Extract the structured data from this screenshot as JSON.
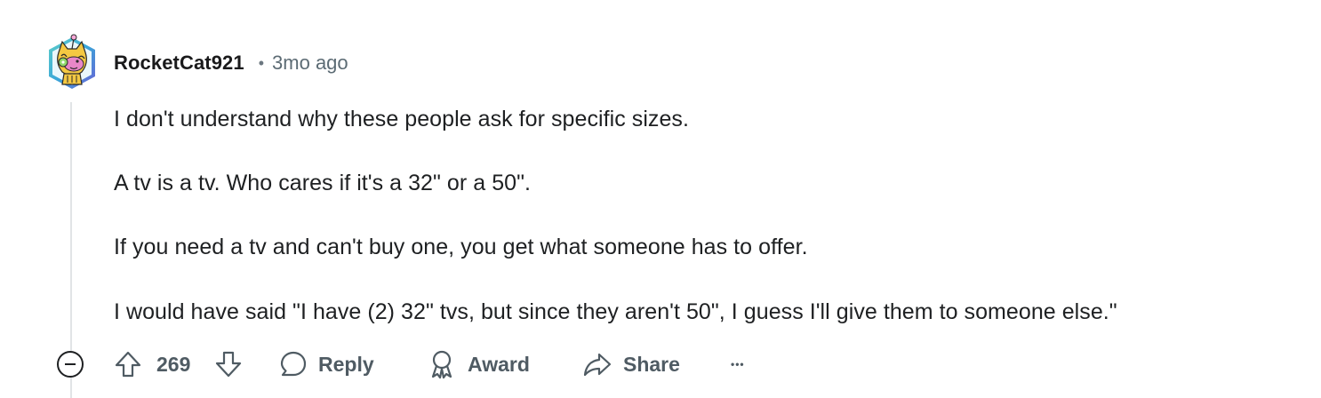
{
  "comment": {
    "author": "RocketCat921",
    "separator": "•",
    "timestamp": "3mo ago",
    "paragraphs": [
      "I don't understand why these people ask for specific sizes.",
      "A tv is a tv. Who cares if it's a 32\" or a 50\".",
      "If you need a tv and can't buy one, you get what someone has to offer.",
      "I would have said \"I have (2) 32\" tvs, but since they aren't 50\", I guess I'll give them to someone else.\""
    ]
  },
  "actions": {
    "score": "269",
    "reply_label": "Reply",
    "award_label": "Award",
    "share_label": "Share",
    "more_label": "•••"
  },
  "icons": {
    "avatar": "snoo-avatar-icon",
    "upvote": "arrow-up-icon",
    "downvote": "arrow-down-icon",
    "reply": "speech-bubble-icon",
    "award": "award-ribbon-icon",
    "share": "share-arrow-icon",
    "collapse": "minus-circle-icon"
  },
  "colors": {
    "text": "#1e2022",
    "meta": "#5c6b74",
    "action": "#4f5b63",
    "thread_line": "#e1e4e6",
    "avatar_bg": "#3ab0c9"
  }
}
